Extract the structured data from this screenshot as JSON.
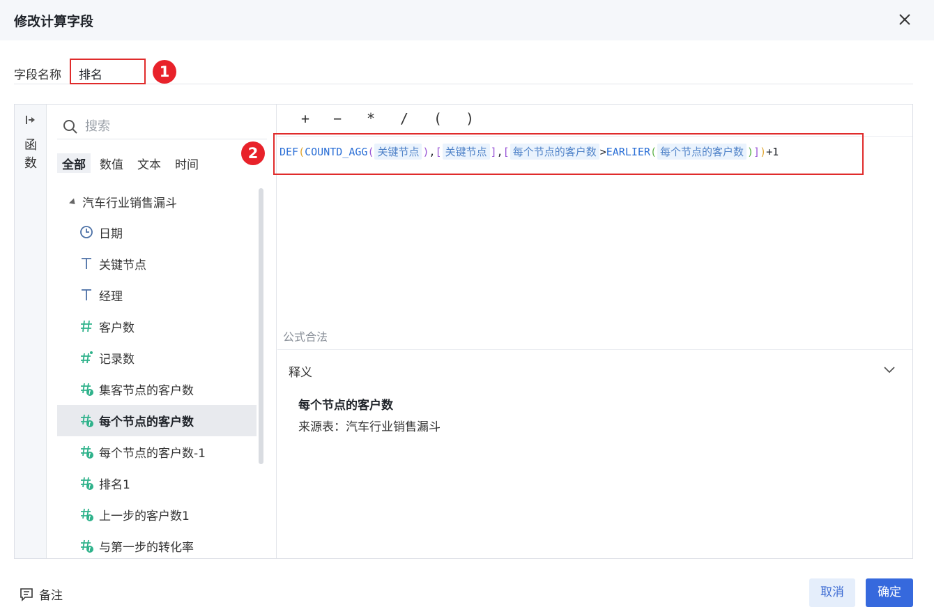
{
  "dialog": {
    "title": "修改计算字段"
  },
  "field_name": {
    "label": "字段名称",
    "value": "排名"
  },
  "badges": [
    "1",
    "2"
  ],
  "function_panel": {
    "label": "函数"
  },
  "search": {
    "placeholder": "搜索"
  },
  "type_tabs": [
    "全部",
    "数值",
    "文本",
    "时间"
  ],
  "tree": {
    "root": "汽车行业销售漏斗",
    "fields": [
      {
        "name": "日期",
        "icon": "clock-icon"
      },
      {
        "name": "关键节点",
        "icon": "text-type-icon"
      },
      {
        "name": "经理",
        "icon": "text-type-icon"
      },
      {
        "name": "客户数",
        "icon": "number-type-icon"
      },
      {
        "name": "记录数",
        "icon": "number-star-icon"
      },
      {
        "name": "集客节点的客户数",
        "icon": "calc-number-icon"
      },
      {
        "name": "每个节点的客户数",
        "icon": "calc-number-icon",
        "selected": true
      },
      {
        "name": "每个节点的客户数-1",
        "icon": "calc-number-icon"
      },
      {
        "name": "排名1",
        "icon": "calc-number-icon"
      },
      {
        "name": "上一步的客户数1",
        "icon": "calc-number-icon"
      },
      {
        "name": "与第一步的转化率",
        "icon": "calc-number-icon"
      }
    ]
  },
  "operators": [
    "+",
    "−",
    "*",
    "/",
    "(",
    ")"
  ],
  "formula": {
    "def": "DEF",
    "countd": "COUNTD_AGG",
    "earlier": "EARLIER",
    "field_key_node": "关键节点",
    "field_key_node_2": "关键节点",
    "field_count_1": "每个节点的客户数",
    "field_count_2": "每个节点的客户数",
    "suffix": "+1"
  },
  "validation": {
    "status": "公式合法"
  },
  "description": {
    "title": "释义",
    "name": "每个节点的客户数",
    "source": "来源表：汽车行业销售漏斗"
  },
  "footer": {
    "note_label": "备注",
    "cancel_label": "取消",
    "ok_label": "确定"
  },
  "colors": {
    "primary": "#3669dd",
    "highlight_red": "#e02b2b",
    "chip_bg": "#eaf3fd"
  }
}
